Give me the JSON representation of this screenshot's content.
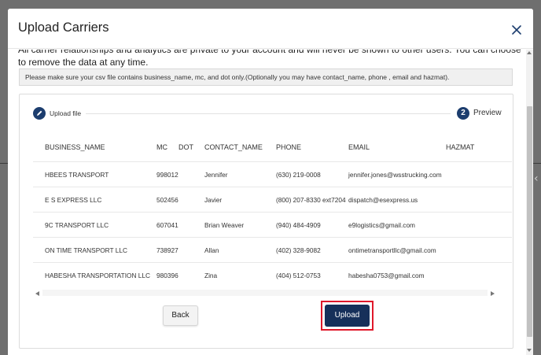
{
  "modal": {
    "title": "Upload Carriers",
    "privacy_text": "All carrier relationships and analytics are private to your account and will never be shown to other users. You can choose to remove the data at any time.",
    "notice": "Please make sure your csv file contains business_name, mc, and dot only.(Optionally you may have contact_name, phone , email and hazmat)."
  },
  "stepper": {
    "step1_label": "Upload file",
    "step2_number": "2",
    "step2_label": "Preview"
  },
  "table": {
    "headers": [
      "BUSINESS_NAME",
      "MC",
      "DOT",
      "CONTACT_NAME",
      "PHONE",
      "EMAIL",
      "HAZMAT"
    ],
    "rows": [
      [
        "HBEES TRANSPORT",
        "998012",
        "",
        "Jennifer",
        "(630) 219-0008",
        "jennifer.jones@wsstrucking.com",
        ""
      ],
      [
        "E S EXPRESS LLC",
        "502456",
        "",
        "Javier",
        "(800) 207-8330 ext7204",
        "dispatch@esexpress.us",
        ""
      ],
      [
        "9C TRANSPORT LLC",
        "607041",
        "",
        "Brian Weaver",
        "(940) 484-4909",
        "e9logistics@gmail.com",
        ""
      ],
      [
        "ON TIME TRANSPORT LLC",
        "738927",
        "",
        "Allan",
        "(402) 328-9082",
        "ontimetransportllc@gmail.com",
        ""
      ],
      [
        "HABESHA TRANSPORTATION LLC",
        "980396",
        "",
        "Zina",
        "(404) 512-0753",
        "habesha0753@gmail.com",
        ""
      ]
    ]
  },
  "buttons": {
    "back": "Back",
    "upload": "Upload"
  },
  "colors": {
    "primary": "#16305a",
    "highlight": "#e0182a"
  }
}
